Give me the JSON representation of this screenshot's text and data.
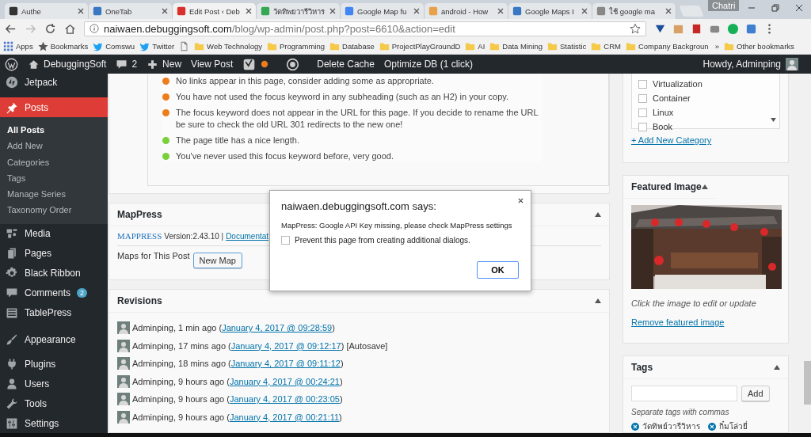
{
  "browser": {
    "tabs": [
      {
        "title": "Authe",
        "kind": "dark",
        "selected": false
      },
      {
        "title": "OneTab",
        "kind": "blue",
        "selected": false
      },
      {
        "title": "Edit Post ‹ Deb",
        "kind": "red",
        "selected": true
      },
      {
        "title": "วัดทิพยวารีวิหาร",
        "kind": "map",
        "selected": false
      },
      {
        "title": "Google Map fu",
        "kind": "google",
        "selected": false
      },
      {
        "title": "android - How",
        "kind": "orange",
        "selected": false
      },
      {
        "title": "Google Maps I",
        "kind": "blue",
        "selected": false
      },
      {
        "title": "ใช้ google ma",
        "kind": "link",
        "selected": false
      }
    ],
    "profile": "Chatri",
    "url_host": "naiwaen.debuggingsoft.com",
    "url_path": "/blog/wp-admin/post.php?post=6610&action=edit",
    "bookmarks": [
      {
        "label": "Apps",
        "kind": "apps"
      },
      {
        "label": "Bookmarks",
        "kind": "star"
      },
      {
        "label": "Comswu",
        "kind": "bird"
      },
      {
        "label": "Twitter",
        "kind": "bird"
      },
      {
        "kind": "page"
      },
      {
        "label": "Web Technology",
        "kind": "folder"
      },
      {
        "label": "Programming",
        "kind": "folder"
      },
      {
        "label": "Database",
        "kind": "folder"
      },
      {
        "label": "ProjectPlayGroundD",
        "kind": "folder"
      },
      {
        "label": "AI",
        "kind": "folder"
      },
      {
        "label": "Data Mining",
        "kind": "folder"
      },
      {
        "label": "Statistic",
        "kind": "folder"
      },
      {
        "label": "CRM",
        "kind": "folder"
      },
      {
        "label": "Company Backgroun",
        "kind": "folder"
      }
    ],
    "bookmarks_more": "»",
    "other_bookmarks": "Other bookmarks"
  },
  "admin_bar": {
    "site": "DebuggingSoft",
    "comments": "2",
    "new": "New",
    "view_post": "View Post",
    "delete_cache": "Delete Cache",
    "optimize": "Optimize DB (1 click)",
    "howdy": "Howdy, Adminping"
  },
  "sidebar": {
    "groups": [
      [
        {
          "label": "Jetpack",
          "kind": "jetpack",
          "selected": false
        },
        {
          "label": "Posts",
          "kind": "pin",
          "selected": true,
          "children": [
            {
              "label": "All Posts",
              "selected": true
            },
            {
              "label": "Add New",
              "selected": false
            },
            {
              "label": "Categories",
              "selected": false
            },
            {
              "label": "Tags",
              "selected": false
            },
            {
              "label": "Manage Series",
              "selected": false
            },
            {
              "label": "Taxonomy Order",
              "selected": false
            }
          ]
        },
        {
          "label": "Media",
          "kind": "media",
          "selected": false
        },
        {
          "label": "Pages",
          "kind": "pages",
          "selected": false
        },
        {
          "label": "Black Ribbon",
          "kind": "gear",
          "selected": false
        },
        {
          "label": "Comments",
          "kind": "comment",
          "selected": false,
          "badge": "2"
        },
        {
          "label": "TablePress",
          "kind": "table",
          "selected": false
        }
      ],
      [
        {
          "label": "Appearance",
          "kind": "brush",
          "selected": false
        },
        {
          "label": "Plugins",
          "kind": "plug",
          "selected": false
        },
        {
          "label": "Users",
          "kind": "user",
          "selected": false
        },
        {
          "label": "Tools",
          "kind": "wrench",
          "selected": false
        },
        {
          "label": "Settings",
          "kind": "sliders",
          "selected": false
        }
      ]
    ]
  },
  "seo_checks": [
    {
      "text": "No links appear in this page, consider adding some as appropriate.",
      "color": "#ee7c1b"
    },
    {
      "text": "You have not used the focus keyword in any subheading (such as an H2) in your copy.",
      "color": "#ee7c1b"
    },
    {
      "text": "The focus keyword does not appear in the URL for this page. If you decide to rename the URL be sure to check the old URL 301 redirects to the new one!",
      "color": "#ee7c1b"
    },
    {
      "text": "The page title has a nice length.",
      "color": "#7ad03a"
    },
    {
      "text": "You've never used this focus keyword before, very good.",
      "color": "#7ad03a"
    }
  ],
  "mappress": {
    "title": "MapPress",
    "logo": "MAPPRESS",
    "version": "Version:2.43.10 |",
    "doc_link": "Documentat",
    "maps_label": "Maps for This Post",
    "new_map": "New Map"
  },
  "revisions": {
    "title": "Revisions",
    "rows": [
      {
        "before": "Adminping, 1 min ago (",
        "date": "January 4, 2017 @ 09:28:59",
        "after": ")"
      },
      {
        "before": "Adminping, 17 mins ago (",
        "date": "January 4, 2017 @ 09:12:17",
        "after": ") [Autosave]"
      },
      {
        "before": "Adminping, 18 mins ago (",
        "date": "January 4, 2017 @ 09:11:12",
        "after": ")"
      },
      {
        "before": "Adminping, 9 hours ago (",
        "date": "January 4, 2017 @ 00:24:21",
        "after": ")"
      },
      {
        "before": "Adminping, 9 hours ago (",
        "date": "January 4, 2017 @ 00:23:05",
        "after": ")"
      },
      {
        "before": "Adminping, 9 hours ago (",
        "date": "January 4, 2017 @ 00:21:11",
        "after": ")"
      }
    ]
  },
  "categories": {
    "items": [
      {
        "label": "Virtualization",
        "checked": false
      },
      {
        "label": "Container",
        "checked": false
      },
      {
        "label": "Linux",
        "checked": false
      },
      {
        "label": "Book",
        "checked": false
      }
    ],
    "add_link": "+ Add New Category"
  },
  "featured_image": {
    "title": "Featured Image",
    "caption": "Click the image to edit or update",
    "remove_link": "Remove featured image"
  },
  "tags": {
    "title": "Tags",
    "add": "Add",
    "hint": "Separate tags with commas",
    "items": [
      "วัดทิพย์วารีวิหาร",
      "กิ๋มโล่วยี่"
    ]
  },
  "dialog": {
    "title": "naiwaen.debuggingsoft.com says:",
    "message": "MapPress: Google API Key missing, please check MapPress settings",
    "prevent": {
      "label": "Prevent this page from creating additional dialogs.",
      "checked": false
    },
    "ok": "OK"
  }
}
